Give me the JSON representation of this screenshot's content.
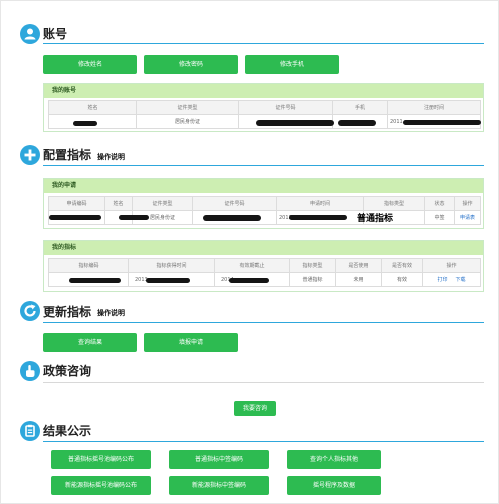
{
  "account": {
    "title": "账号",
    "buttons": [
      "修改姓名",
      "修改密码",
      "修改手机"
    ],
    "panel_title": "我的账号",
    "headers": [
      "姓名",
      "证件类型",
      "证件号码",
      "手机",
      "注册时间"
    ],
    "row": {
      "id_type": "居民身份证",
      "reg_time": "2011"
    }
  },
  "config": {
    "title": "配置指标",
    "sub": "操作说明",
    "apply_panel_title": "我的申请",
    "apply_headers": [
      "申请编码",
      "姓名",
      "证件类型",
      "证件号码",
      "申请时间",
      "指标类型",
      "状态",
      "操作"
    ],
    "apply_row": {
      "id_type": "居民身份证",
      "apply_time": "2013",
      "index_type": "普通指标",
      "status": "中签",
      "action": "申请表"
    },
    "index_panel_title": "我的指标",
    "index_headers": [
      "指标编码",
      "指标获得时间",
      "有效期截止",
      "指标类型",
      "是否使用",
      "是否有效",
      "操作"
    ],
    "index_row": {
      "get_time": "2013",
      "expire": "2014",
      "index_type": "普通指标",
      "used": "未用",
      "valid": "有效",
      "print": "打印",
      "download": "下载"
    }
  },
  "update": {
    "title": "更新指标",
    "sub": "操作说明",
    "buttons": [
      "查询结果",
      "填报申请"
    ]
  },
  "policy": {
    "title": "政策咨询",
    "button": "我要咨询"
  },
  "results": {
    "title": "结果公示",
    "buttons": [
      "普通指标摇号池编码公布",
      "普通指标中签编码",
      "查询个人指标其他",
      "新能源指标摇号池编码公布",
      "新能源指标中签编码",
      "摇号程序及数据"
    ]
  },
  "colors": {
    "accent": "#2ea7dc",
    "button_green": "#2dbb51",
    "panel_head": "#cdeeb2"
  }
}
